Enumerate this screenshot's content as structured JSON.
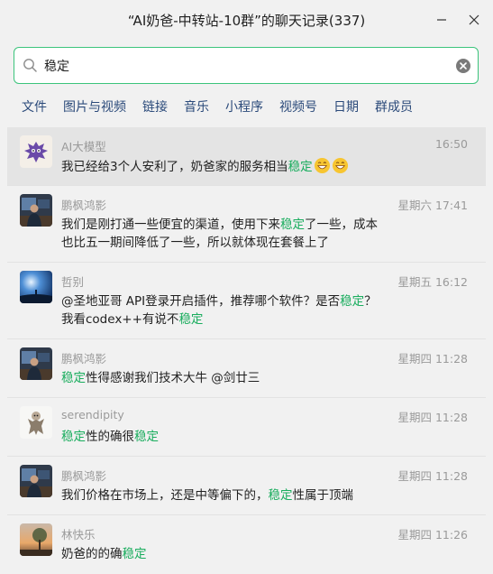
{
  "window": {
    "title": "“AI奶爸-中转站-10群”的聊天记录(337)"
  },
  "search": {
    "value": "稳定",
    "placeholder": ""
  },
  "filters": [
    "文件",
    "图片与视频",
    "链接",
    "音乐",
    "小程序",
    "视频号",
    "日期",
    "群成员"
  ],
  "highlight_color": "#1aad5e",
  "accent_color": "#3cc47c",
  "messages": [
    {
      "sender": "AI大模型",
      "time": "16:50",
      "avatar_icon": "purple-monster-avatar-icon",
      "parts": [
        {
          "t": "我已经给3个人安利了，奶爸家的服务相当"
        },
        {
          "t": "稳定",
          "hl": true
        }
      ],
      "emojis": [
        "grin-emoji-icon",
        "grin-emoji-icon"
      ]
    },
    {
      "sender": "鹏枫鸿影",
      "time": "星期六 17:41",
      "avatar_icon": "person-at-desk-avatar-icon",
      "parts": [
        {
          "t": "我们是刚打通一些便宜的渠道，使用下来"
        },
        {
          "t": "稳定",
          "hl": true
        },
        {
          "t": "了一些，成本也比五一期间降低了一些，所以就体现在套餐上了"
        }
      ]
    },
    {
      "sender": "哲别",
      "time": "星期五 16:12",
      "avatar_icon": "starry-sky-avatar-icon",
      "parts": [
        {
          "t": "@圣地亚哥 API登录开启插件，推荐哪个软件？是否"
        },
        {
          "t": "稳定",
          "hl": true
        },
        {
          "t": "？我看codex++有说不"
        },
        {
          "t": "稳定",
          "hl": true
        }
      ]
    },
    {
      "sender": "鹏枫鸿影",
      "time": "星期四 11:28",
      "avatar_icon": "person-at-desk-avatar-icon",
      "parts": [
        {
          "t": "稳定",
          "hl": true
        },
        {
          "t": "性得感谢我们技术大牛 @剑廿三"
        }
      ]
    },
    {
      "sender": "serendipity",
      "time": "星期四 11:28",
      "avatar_icon": "sketch-figure-avatar-icon",
      "parts": [
        {
          "t": "稳定",
          "hl": true
        },
        {
          "t": "性的确很"
        },
        {
          "t": "稳定",
          "hl": true
        }
      ]
    },
    {
      "sender": "鹏枫鸿影",
      "time": "星期四 11:28",
      "avatar_icon": "person-at-desk-avatar-icon",
      "parts": [
        {
          "t": "我们价格在市场上，还是中等偏下的，"
        },
        {
          "t": "稳定",
          "hl": true
        },
        {
          "t": "性属于顶端"
        }
      ]
    },
    {
      "sender": "林快乐",
      "time": "星期四 11:26",
      "avatar_icon": "sunset-tree-avatar-icon",
      "parts": [
        {
          "t": "奶爸的的确"
        },
        {
          "t": "稳定",
          "hl": true
        }
      ]
    }
  ]
}
